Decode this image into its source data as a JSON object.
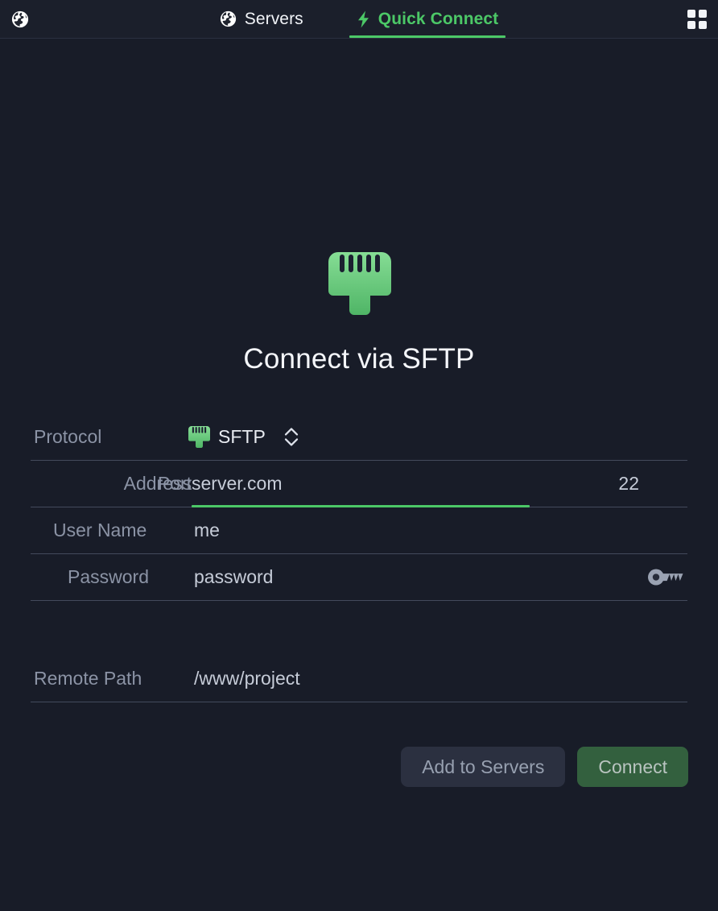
{
  "topbar": {
    "app_icon": "globe-icon",
    "menu_icon": "grid-icon",
    "tabs": [
      {
        "label": "Servers",
        "icon": "globe-icon",
        "active": false
      },
      {
        "label": "Quick Connect",
        "icon": "lightning-bolt-icon",
        "active": true
      }
    ]
  },
  "main": {
    "hero_icon": "ethernet-port-icon",
    "title": "Connect via SFTP"
  },
  "form": {
    "protocol": {
      "label": "Protocol",
      "icon": "ethernet-port-icon",
      "value": "SFTP",
      "stepper_icon": "chevron-up-down-icon"
    },
    "address": {
      "label": "Address",
      "value": "server.com"
    },
    "port": {
      "label": "Port",
      "value": "22"
    },
    "username": {
      "label": "User Name",
      "value": "me"
    },
    "password": {
      "label": "Password",
      "value": "password",
      "icon": "key-icon"
    },
    "remote_path": {
      "label": "Remote Path",
      "value": "/www/project"
    }
  },
  "actions": {
    "add_to_servers": "Add to Servers",
    "connect": "Connect"
  },
  "colors": {
    "accent_green": "#4cc867",
    "background": "#181c28",
    "topbar": "#1b1f2b",
    "primary_button": "#33603e",
    "secondary_button": "#2b3040",
    "label_text": "#8b93a5",
    "value_text": "#c6ccd8"
  }
}
